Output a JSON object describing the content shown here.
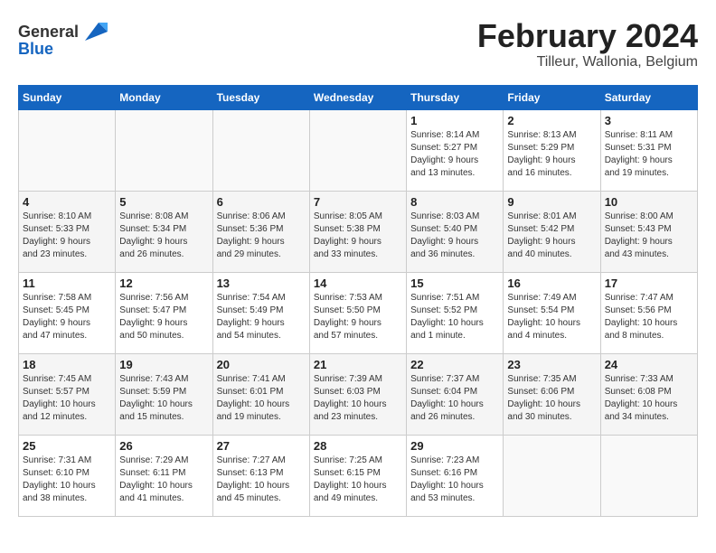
{
  "header": {
    "logo_general": "General",
    "logo_blue": "Blue",
    "title": "February 2024",
    "subtitle": "Tilleur, Wallonia, Belgium"
  },
  "days_of_week": [
    "Sunday",
    "Monday",
    "Tuesday",
    "Wednesday",
    "Thursday",
    "Friday",
    "Saturday"
  ],
  "weeks": [
    [
      {
        "date": "",
        "info": ""
      },
      {
        "date": "",
        "info": ""
      },
      {
        "date": "",
        "info": ""
      },
      {
        "date": "",
        "info": ""
      },
      {
        "date": "1",
        "info": "Sunrise: 8:14 AM\nSunset: 5:27 PM\nDaylight: 9 hours\nand 13 minutes."
      },
      {
        "date": "2",
        "info": "Sunrise: 8:13 AM\nSunset: 5:29 PM\nDaylight: 9 hours\nand 16 minutes."
      },
      {
        "date": "3",
        "info": "Sunrise: 8:11 AM\nSunset: 5:31 PM\nDaylight: 9 hours\nand 19 minutes."
      }
    ],
    [
      {
        "date": "4",
        "info": "Sunrise: 8:10 AM\nSunset: 5:33 PM\nDaylight: 9 hours\nand 23 minutes."
      },
      {
        "date": "5",
        "info": "Sunrise: 8:08 AM\nSunset: 5:34 PM\nDaylight: 9 hours\nand 26 minutes."
      },
      {
        "date": "6",
        "info": "Sunrise: 8:06 AM\nSunset: 5:36 PM\nDaylight: 9 hours\nand 29 minutes."
      },
      {
        "date": "7",
        "info": "Sunrise: 8:05 AM\nSunset: 5:38 PM\nDaylight: 9 hours\nand 33 minutes."
      },
      {
        "date": "8",
        "info": "Sunrise: 8:03 AM\nSunset: 5:40 PM\nDaylight: 9 hours\nand 36 minutes."
      },
      {
        "date": "9",
        "info": "Sunrise: 8:01 AM\nSunset: 5:42 PM\nDaylight: 9 hours\nand 40 minutes."
      },
      {
        "date": "10",
        "info": "Sunrise: 8:00 AM\nSunset: 5:43 PM\nDaylight: 9 hours\nand 43 minutes."
      }
    ],
    [
      {
        "date": "11",
        "info": "Sunrise: 7:58 AM\nSunset: 5:45 PM\nDaylight: 9 hours\nand 47 minutes."
      },
      {
        "date": "12",
        "info": "Sunrise: 7:56 AM\nSunset: 5:47 PM\nDaylight: 9 hours\nand 50 minutes."
      },
      {
        "date": "13",
        "info": "Sunrise: 7:54 AM\nSunset: 5:49 PM\nDaylight: 9 hours\nand 54 minutes."
      },
      {
        "date": "14",
        "info": "Sunrise: 7:53 AM\nSunset: 5:50 PM\nDaylight: 9 hours\nand 57 minutes."
      },
      {
        "date": "15",
        "info": "Sunrise: 7:51 AM\nSunset: 5:52 PM\nDaylight: 10 hours\nand 1 minute."
      },
      {
        "date": "16",
        "info": "Sunrise: 7:49 AM\nSunset: 5:54 PM\nDaylight: 10 hours\nand 4 minutes."
      },
      {
        "date": "17",
        "info": "Sunrise: 7:47 AM\nSunset: 5:56 PM\nDaylight: 10 hours\nand 8 minutes."
      }
    ],
    [
      {
        "date": "18",
        "info": "Sunrise: 7:45 AM\nSunset: 5:57 PM\nDaylight: 10 hours\nand 12 minutes."
      },
      {
        "date": "19",
        "info": "Sunrise: 7:43 AM\nSunset: 5:59 PM\nDaylight: 10 hours\nand 15 minutes."
      },
      {
        "date": "20",
        "info": "Sunrise: 7:41 AM\nSunset: 6:01 PM\nDaylight: 10 hours\nand 19 minutes."
      },
      {
        "date": "21",
        "info": "Sunrise: 7:39 AM\nSunset: 6:03 PM\nDaylight: 10 hours\nand 23 minutes."
      },
      {
        "date": "22",
        "info": "Sunrise: 7:37 AM\nSunset: 6:04 PM\nDaylight: 10 hours\nand 26 minutes."
      },
      {
        "date": "23",
        "info": "Sunrise: 7:35 AM\nSunset: 6:06 PM\nDaylight: 10 hours\nand 30 minutes."
      },
      {
        "date": "24",
        "info": "Sunrise: 7:33 AM\nSunset: 6:08 PM\nDaylight: 10 hours\nand 34 minutes."
      }
    ],
    [
      {
        "date": "25",
        "info": "Sunrise: 7:31 AM\nSunset: 6:10 PM\nDaylight: 10 hours\nand 38 minutes."
      },
      {
        "date": "26",
        "info": "Sunrise: 7:29 AM\nSunset: 6:11 PM\nDaylight: 10 hours\nand 41 minutes."
      },
      {
        "date": "27",
        "info": "Sunrise: 7:27 AM\nSunset: 6:13 PM\nDaylight: 10 hours\nand 45 minutes."
      },
      {
        "date": "28",
        "info": "Sunrise: 7:25 AM\nSunset: 6:15 PM\nDaylight: 10 hours\nand 49 minutes."
      },
      {
        "date": "29",
        "info": "Sunrise: 7:23 AM\nSunset: 6:16 PM\nDaylight: 10 hours\nand 53 minutes."
      },
      {
        "date": "",
        "info": ""
      },
      {
        "date": "",
        "info": ""
      }
    ]
  ]
}
